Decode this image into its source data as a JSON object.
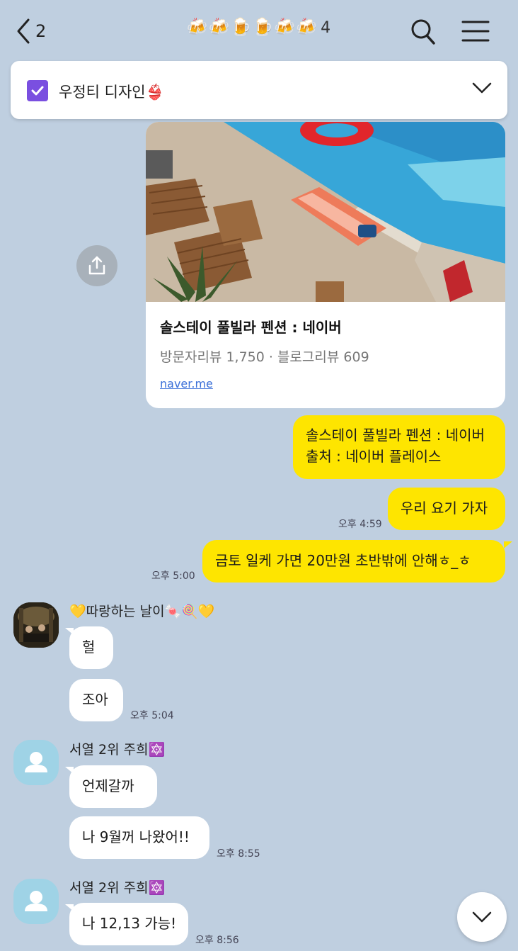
{
  "header": {
    "back_count": "2",
    "title": "🍻🍻🍺🍺🍻🍻",
    "member_count": "4"
  },
  "notice": {
    "text": "우정티 디자인👙"
  },
  "link_card": {
    "title": "솔스테이 풀빌라 펜션 : 네이버",
    "subtitle": "방문자리뷰 1,750 · 블로그리뷰 609",
    "link": "naver.me"
  },
  "messages": {
    "m1": {
      "text_line1": "솔스테이 풀빌라 펜션 : 네이버",
      "text_line2": "출처 : 네이버 플레이스"
    },
    "m2": {
      "text": "우리 요기 가자",
      "time": "오후 4:59"
    },
    "m3": {
      "text": "금토 일케 가면 20만원 초반밖에 안해ㅎ_ㅎ",
      "time": "오후 5:00"
    },
    "sender1": {
      "name": "💛따랑하는 날이🍬🍭💛"
    },
    "m4": {
      "text": "헐"
    },
    "m5": {
      "text": "조아",
      "time": "오후 5:04"
    },
    "sender2": {
      "name": "서열 2위 주희🔯"
    },
    "m6": {
      "text": "언제갈까"
    },
    "m7": {
      "text": "나 9월꺼 나왔어!!",
      "time": "오후 8:55"
    },
    "sender3": {
      "name": "서열 2위 주희🔯"
    },
    "m8": {
      "text": "나 12,13 가능!",
      "time": "오후 8:56"
    }
  },
  "colors": {
    "background": "#bfcfe0",
    "my_bubble": "#fee500",
    "accent": "#7a4fe0"
  }
}
